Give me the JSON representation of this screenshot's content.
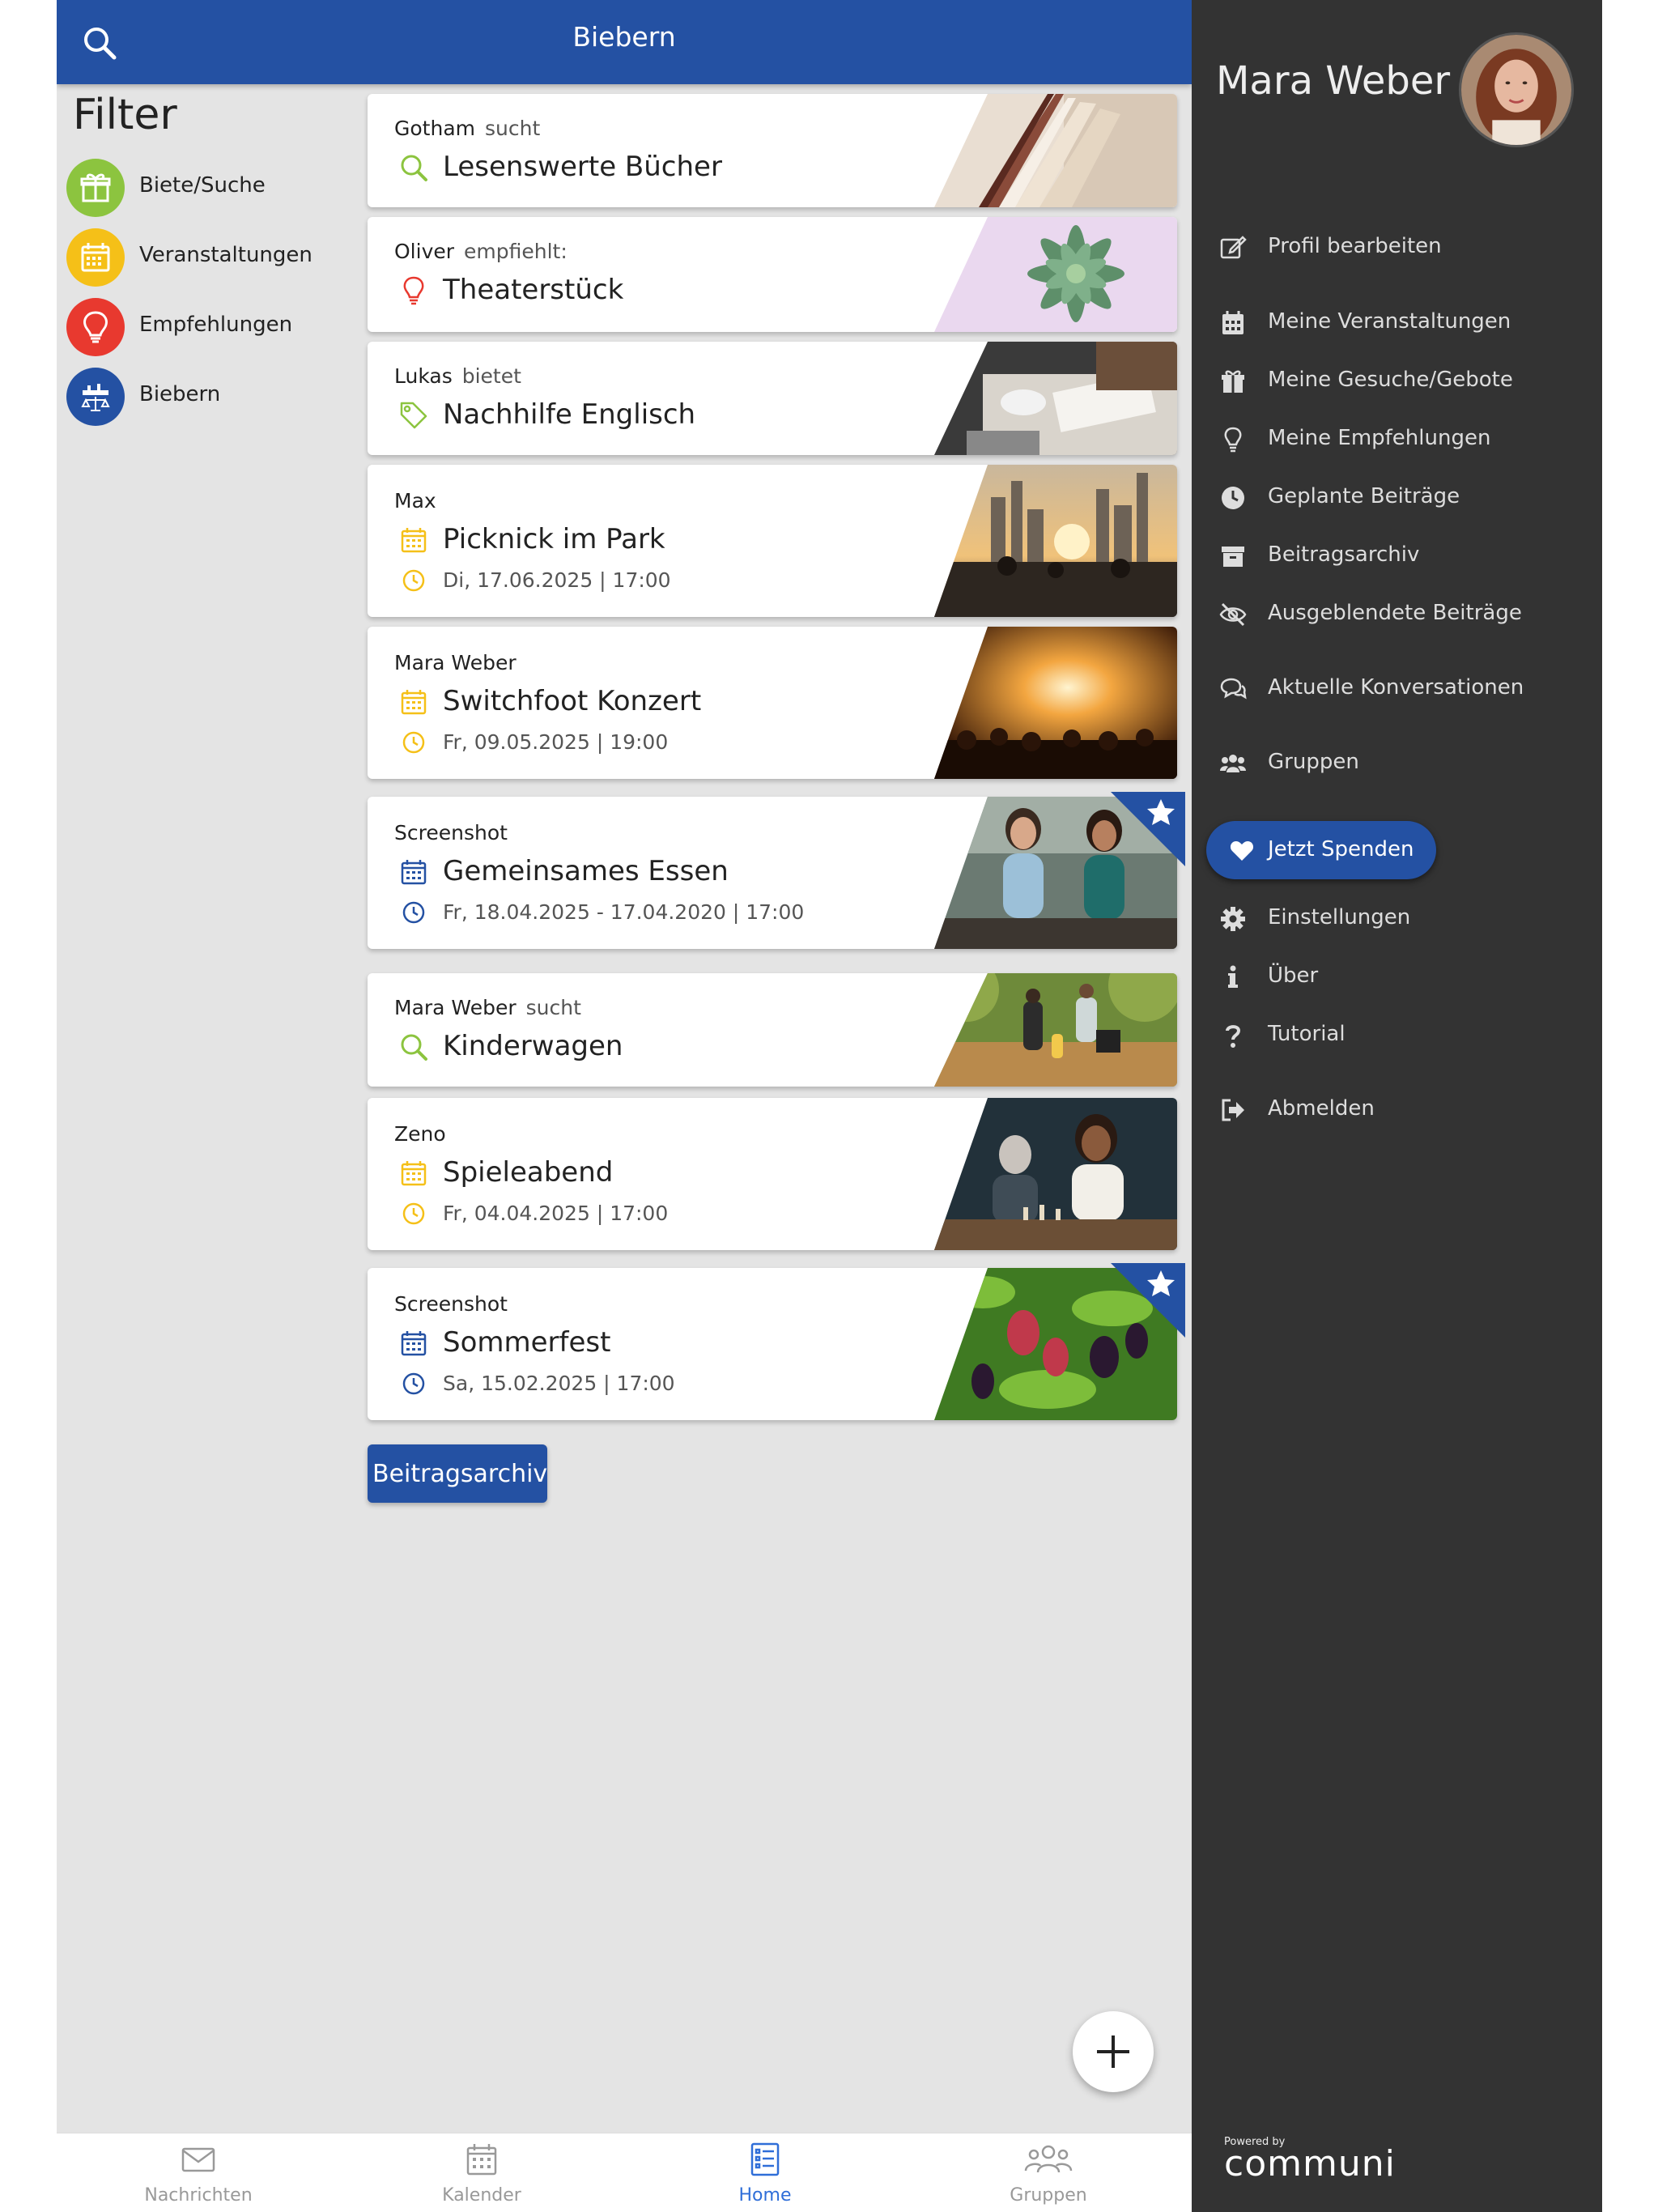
{
  "header": {
    "title": "Biebern"
  },
  "filter": {
    "title": "Filter",
    "items": [
      {
        "label": "Biete/Suche",
        "color": "#8cc43f",
        "icon": "gift-icon"
      },
      {
        "label": "Veranstaltungen",
        "color": "#f5c018",
        "icon": "calendar-icon"
      },
      {
        "label": "Empfehlungen",
        "color": "#e8392f",
        "icon": "lightbulb-icon"
      },
      {
        "label": "Biebern",
        "color": "#2451a3",
        "icon": "community-icon"
      }
    ]
  },
  "posts": [
    {
      "author": "Gotham",
      "verb": "sucht",
      "title": "Lesenswerte Bücher",
      "icon": "search-icon",
      "image": "open-book"
    },
    {
      "author": "Oliver",
      "verb": "empfiehlt:",
      "title": "Theaterstück",
      "icon": "lightbulb-icon",
      "image": "succulent"
    },
    {
      "author": "Lukas",
      "verb": "bietet",
      "title": "Nachhilfe Englisch",
      "icon": "tag-icon",
      "image": "desk"
    },
    {
      "author": "Max",
      "verb": "",
      "title": "Picknick im Park",
      "icon": "calendar-icon",
      "date": "Di, 17.06.2025 | 17:00",
      "image": "city-sunset"
    },
    {
      "author": "Mara Weber",
      "verb": "",
      "title": "Switchfoot Konzert",
      "icon": "calendar-icon",
      "date": "Fr, 09.05.2025 | 19:00",
      "image": "concert"
    },
    {
      "author": "Screenshot",
      "verb": "",
      "title": "Gemeinsames Essen",
      "icon": "calendar-icon",
      "date": "Fr, 18.04.2025 - 17.04.2020 | 17:00",
      "image": "friends",
      "featured": true
    },
    {
      "author": "Mara Weber",
      "verb": "sucht",
      "title": "Kinderwagen",
      "icon": "search-icon",
      "image": "park-walk"
    },
    {
      "author": "Zeno",
      "verb": "",
      "title": "Spieleabend",
      "icon": "calendar-icon",
      "date": "Fr, 04.04.2025 | 17:00",
      "image": "chess"
    },
    {
      "author": "Screenshot",
      "verb": "",
      "title": "Sommerfest",
      "icon": "calendar-icon",
      "date": "Sa, 15.02.2025 | 17:00",
      "image": "berries",
      "featured": true
    }
  ],
  "archive_button": "Beitragsarchiv",
  "bottom_nav": [
    {
      "label": "Nachrichten",
      "icon": "envelope-icon",
      "active": false
    },
    {
      "label": "Kalender",
      "icon": "calendar-icon",
      "active": false
    },
    {
      "label": "Home",
      "icon": "list-icon",
      "active": true
    },
    {
      "label": "Gruppen",
      "icon": "group-icon",
      "active": false
    }
  ],
  "drawer": {
    "user_name": "Mara Weber",
    "menu": [
      {
        "label": "Profil bearbeiten",
        "icon": "edit-icon"
      },
      {
        "label": "Meine Veranstaltungen",
        "icon": "calendar-icon"
      },
      {
        "label": "Meine Gesuche/Gebote",
        "icon": "gift-icon"
      },
      {
        "label": "Meine Empfehlungen",
        "icon": "lightbulb-icon"
      },
      {
        "label": "Geplante Beiträge",
        "icon": "clock-icon"
      },
      {
        "label": "Beitragsarchiv",
        "icon": "archive-icon"
      },
      {
        "label": "Ausgeblendete Beiträge",
        "icon": "eye-slash-icon"
      },
      {
        "label": "Aktuelle Konversationen",
        "icon": "chat-icon"
      },
      {
        "label": "Gruppen",
        "icon": "users-icon"
      }
    ],
    "donate": "Jetzt Spenden",
    "menu2": [
      {
        "label": "Einstellungen",
        "icon": "gear-icon"
      },
      {
        "label": "Über",
        "icon": "info-icon"
      },
      {
        "label": "Tutorial",
        "icon": "question-icon"
      },
      {
        "label": "Abmelden",
        "icon": "logout-icon"
      }
    ],
    "powered_by": "Powered by",
    "brand": "communi"
  },
  "colors": {
    "primary": "#2451a3",
    "green": "#8cc43f",
    "yellow": "#f5c018",
    "red": "#e8392f",
    "drawer_bg": "#333333"
  }
}
